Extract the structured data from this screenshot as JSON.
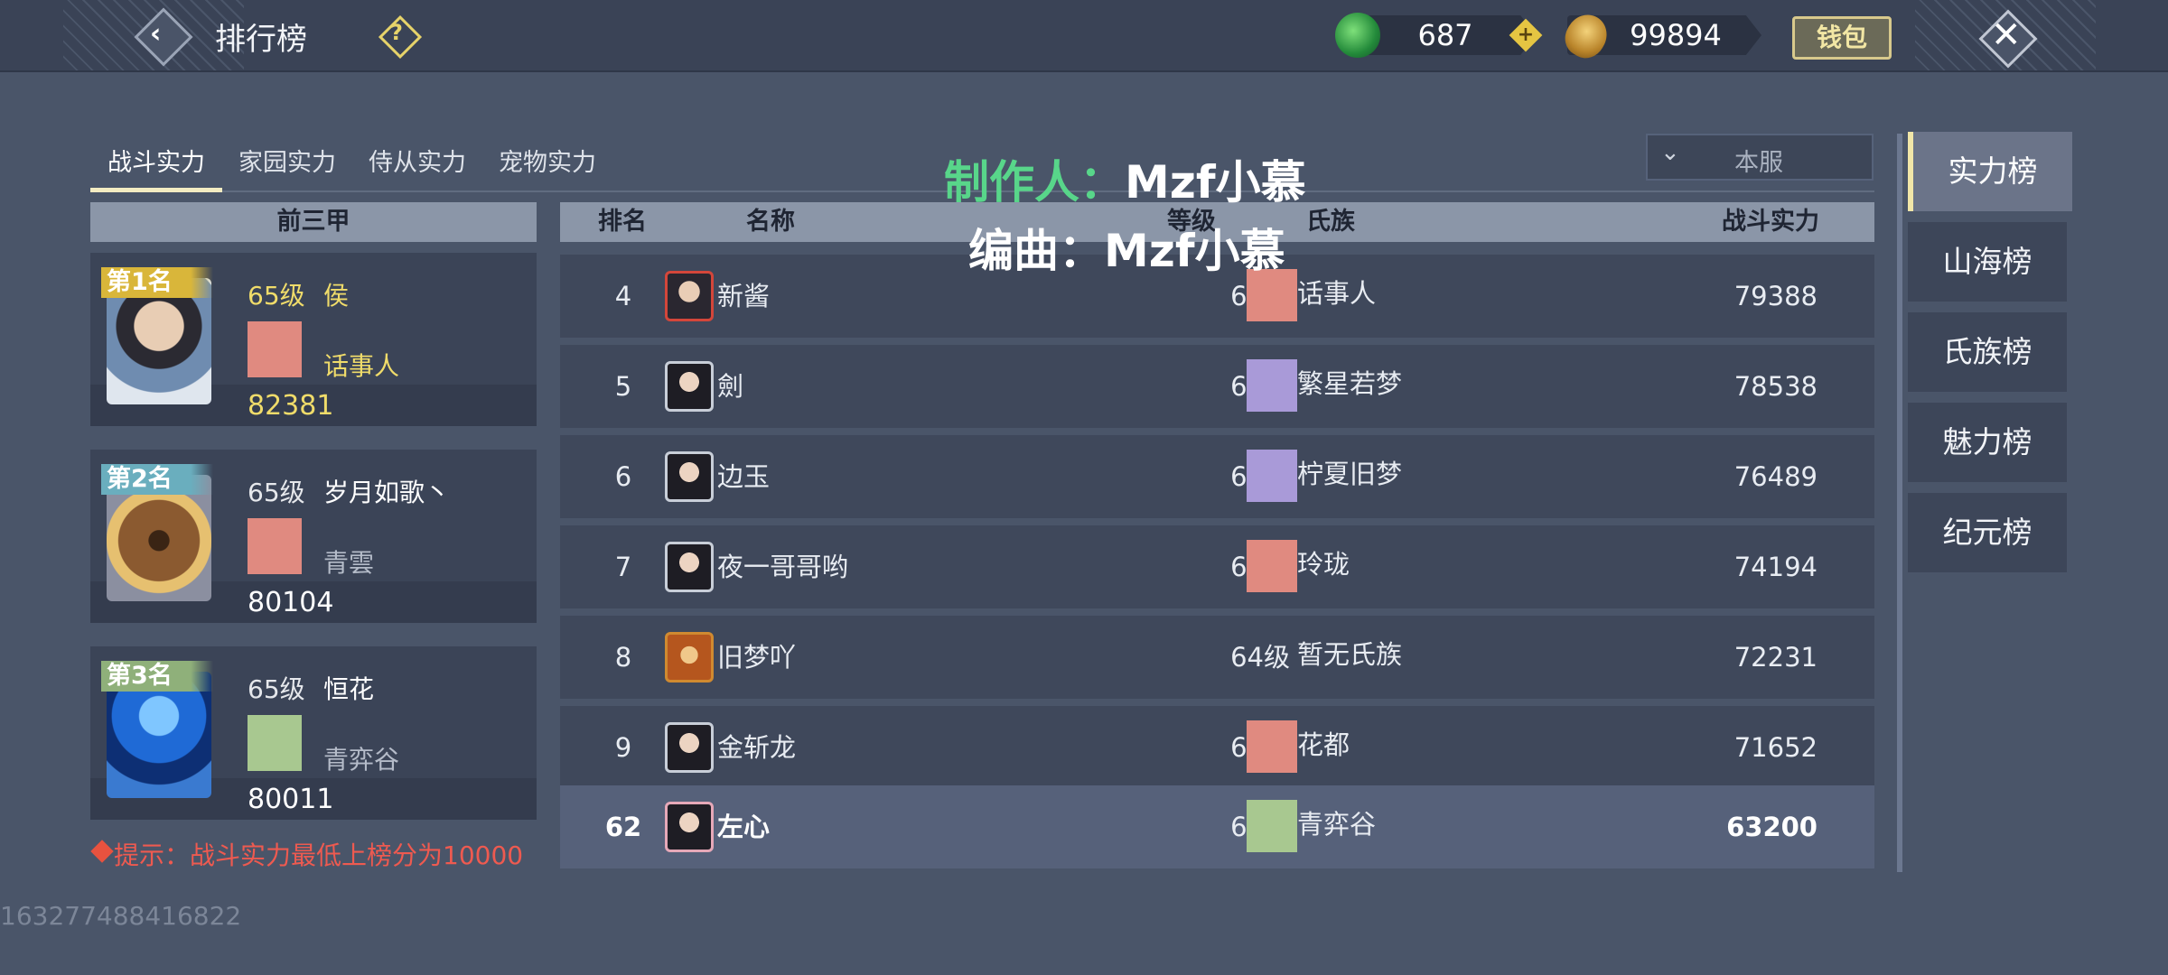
{
  "header": {
    "title": "排行榜",
    "help_icon": "question-diamond-icon",
    "back_icon": "back-arrow-icon",
    "close_icon": "close-cross-icon",
    "jade_amount": "687",
    "gold_amount": "99894",
    "wallet_label": "钱包"
  },
  "tabs": [
    {
      "label": "战斗实力",
      "active": true
    },
    {
      "label": "家园实力",
      "active": false
    },
    {
      "label": "侍从实力",
      "active": false
    },
    {
      "label": "宠物实力",
      "active": false
    }
  ],
  "overlay": {
    "producer_prefix": "制作人：",
    "producer_name": "Mzf小慕",
    "composer": "编曲：Mzf小慕"
  },
  "server_select": {
    "value": "本服"
  },
  "top3": {
    "header": "前三甲",
    "cards": [
      {
        "rank_label": "第1名",
        "level": "65级",
        "name": "侯",
        "clan": "话事人",
        "power": "82381",
        "ribbon_color": "#d9b63a"
      },
      {
        "rank_label": "第2名",
        "level": "65级",
        "name": "岁月如歌丶",
        "clan": "青雲",
        "power": "80104",
        "ribbon_color": "#6aaebe"
      },
      {
        "rank_label": "第3名",
        "level": "65级",
        "name": "恒花",
        "clan": "青弈谷",
        "power": "80011",
        "ribbon_color": "#8fb07a"
      }
    ]
  },
  "tip": "提示：战斗实力最低上榜分为10000",
  "uid": "163277488416822",
  "table": {
    "headers": {
      "rank": "排名",
      "name": "名称",
      "level": "等级",
      "clan": "氏族",
      "power": "战斗实力"
    },
    "rows": [
      {
        "rank": "4",
        "name": "新酱",
        "level": "65级",
        "clan": "话事人",
        "power": "79388",
        "clan_color": "#e08a80"
      },
      {
        "rank": "5",
        "name": "劍",
        "level": "65级",
        "clan": "繁星若梦",
        "power": "78538",
        "clan_color": "#a99ad8"
      },
      {
        "rank": "6",
        "name": "边玉",
        "level": "65级",
        "clan": "柠夏旧梦",
        "power": "76489",
        "clan_color": "#a99ad8"
      },
      {
        "rank": "7",
        "name": "夜一哥哥哟",
        "level": "65级",
        "clan": "玲珑",
        "power": "74194",
        "clan_color": "#e08a80"
      },
      {
        "rank": "8",
        "name": "旧梦吖",
        "level": "64级",
        "clan": "暂无氏族",
        "power": "72231",
        "clan_color": ""
      },
      {
        "rank": "9",
        "name": "金斩龙",
        "level": "65级",
        "clan": "花都",
        "power": "71652",
        "clan_color": "#e08a80"
      }
    ],
    "self_row": {
      "rank": "62",
      "name": "左心",
      "level": "65级",
      "clan": "青弈谷",
      "power": "63200",
      "clan_color": "#a8c890"
    }
  },
  "side_tabs": [
    {
      "label": "实力榜",
      "active": true
    },
    {
      "label": "山海榜",
      "active": false
    },
    {
      "label": "氏族榜",
      "active": false
    },
    {
      "label": "魅力榜",
      "active": false
    },
    {
      "label": "纪元榜",
      "active": false
    }
  ]
}
